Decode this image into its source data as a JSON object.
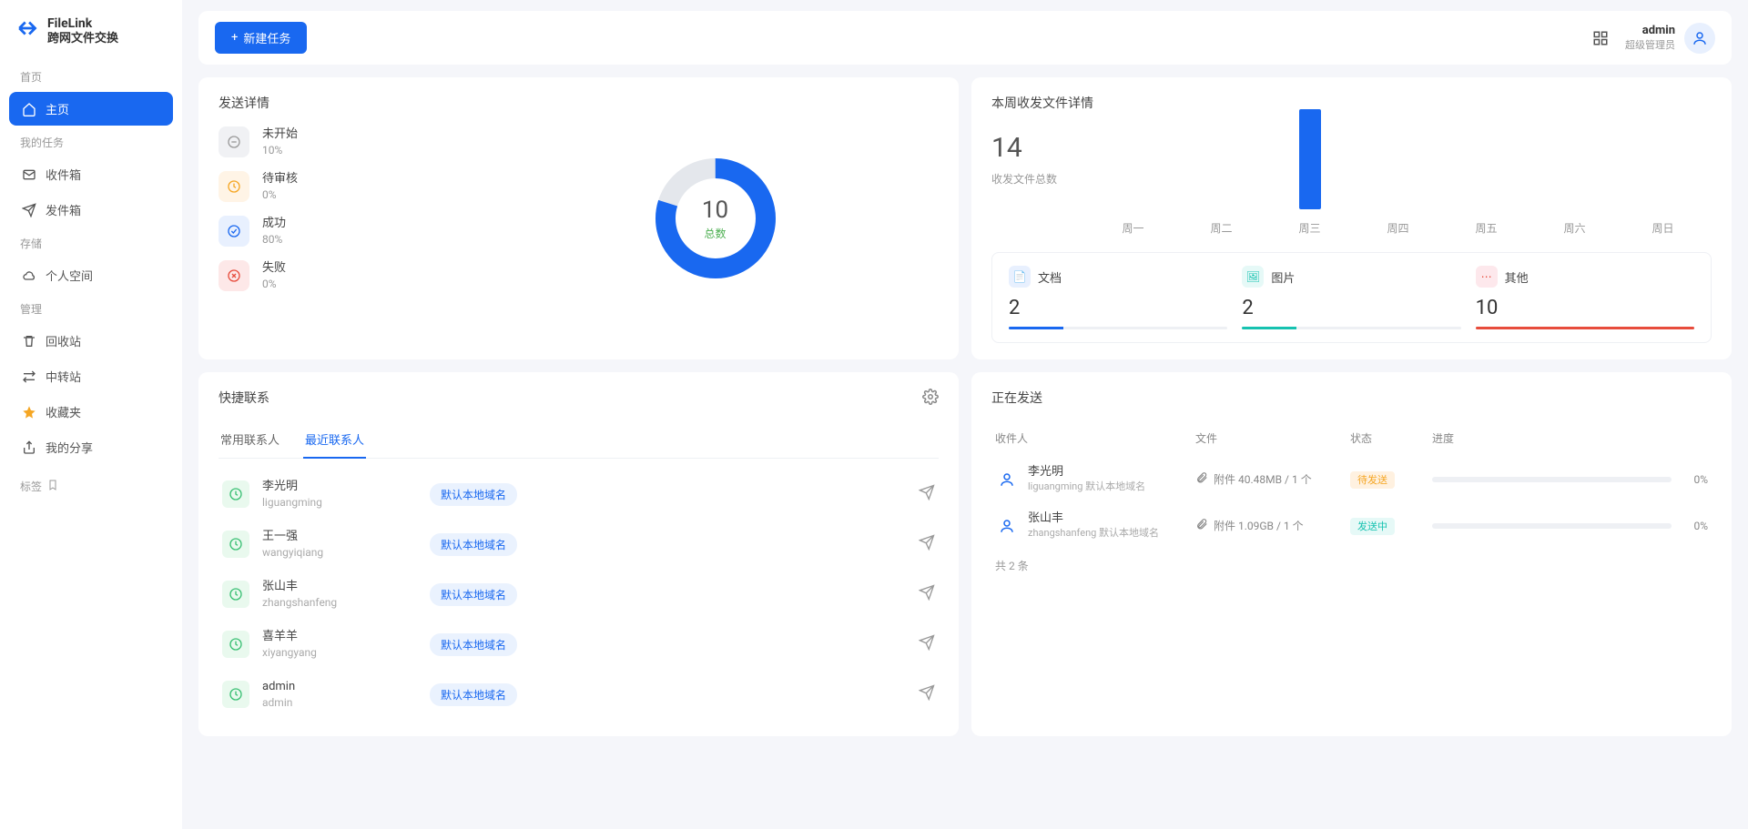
{
  "brand": {
    "main": "FileLink",
    "sub": "跨网文件交换"
  },
  "nav": {
    "sections": {
      "home_label": "首页",
      "tasks_label": "我的任务",
      "storage_label": "存储",
      "admin_label": "管理",
      "bookmark_label": "标签"
    },
    "items": {
      "home": "主页",
      "inbox": "收件箱",
      "outbox": "发件箱",
      "personal": "个人空间",
      "recycle": "回收站",
      "transfer": "中转站",
      "favorites": "收藏夹",
      "shared": "我的分享"
    }
  },
  "topbar": {
    "new_task": "新建任务",
    "user": {
      "name": "admin",
      "role": "超级管理员"
    }
  },
  "send_detail": {
    "title": "发送详情",
    "statuses": [
      {
        "label": "未开始",
        "pct": "10%",
        "value": 10
      },
      {
        "label": "待审核",
        "pct": "0%",
        "value": 0
      },
      {
        "label": "成功",
        "pct": "80%",
        "value": 80
      },
      {
        "label": "失败",
        "pct": "0%",
        "value": 0
      }
    ],
    "total": {
      "value": "10",
      "label": "总数"
    }
  },
  "chart_data": [
    {
      "type": "pie",
      "title": "发送详情",
      "series": [
        {
          "name": "未开始",
          "value": 10
        },
        {
          "name": "待审核",
          "value": 0
        },
        {
          "name": "成功",
          "value": 80
        },
        {
          "name": "失败",
          "value": 0
        }
      ],
      "total": 10
    },
    {
      "type": "bar",
      "title": "本周收发文件详情",
      "categories": [
        "周一",
        "周二",
        "周三",
        "周四",
        "周五",
        "周六",
        "周日"
      ],
      "values": [
        0,
        0,
        14,
        0,
        0,
        0,
        0
      ],
      "ylabel": "收发文件总数"
    }
  ],
  "week": {
    "title": "本周收发文件详情",
    "total_value": "14",
    "total_label": "收发文件总数",
    "days": [
      {
        "label": "周一",
        "value": 0
      },
      {
        "label": "周二",
        "value": 0
      },
      {
        "label": "周三",
        "value": 14
      },
      {
        "label": "周四",
        "value": 0
      },
      {
        "label": "周五",
        "value": 0
      },
      {
        "label": "周六",
        "value": 0
      },
      {
        "label": "周日",
        "value": 0
      }
    ],
    "file_types": [
      {
        "name": "文档",
        "value": "2",
        "color_class": "fb-blue",
        "icon_class": "fti-doc"
      },
      {
        "name": "图片",
        "value": "2",
        "color_class": "fb-teal",
        "icon_class": "fti-img"
      },
      {
        "name": "其他",
        "value": "10",
        "color_class": "fb-red",
        "icon_class": "fti-other"
      }
    ]
  },
  "contacts": {
    "title": "快捷联系",
    "tabs": {
      "frequent": "常用联系人",
      "recent": "最近联系人"
    },
    "chip": "默认本地域名",
    "list": [
      {
        "name": "李光明",
        "id": "liguangming"
      },
      {
        "name": "王一强",
        "id": "wangyiqiang"
      },
      {
        "name": "张山丰",
        "id": "zhangshanfeng"
      },
      {
        "name": "喜羊羊",
        "id": "xiyangyang"
      },
      {
        "name": "admin",
        "id": "admin"
      }
    ]
  },
  "sending": {
    "title": "正在发送",
    "headers": {
      "recv": "收件人",
      "file": "文件",
      "status": "状态",
      "prog": "进度"
    },
    "rows": [
      {
        "name": "李光明",
        "id": "liguangming",
        "domain": "默认本地域名",
        "file": "附件 40.48MB / 1 个",
        "status": "待发送",
        "status_class": "badge-wait",
        "pct": "0%"
      },
      {
        "name": "张山丰",
        "id": "zhangshanfeng",
        "domain": "默认本地域名",
        "file": "附件 1.09GB / 1 个",
        "status": "发送中",
        "status_class": "badge-sending",
        "pct": "0%"
      }
    ],
    "total": "共 2 条"
  }
}
